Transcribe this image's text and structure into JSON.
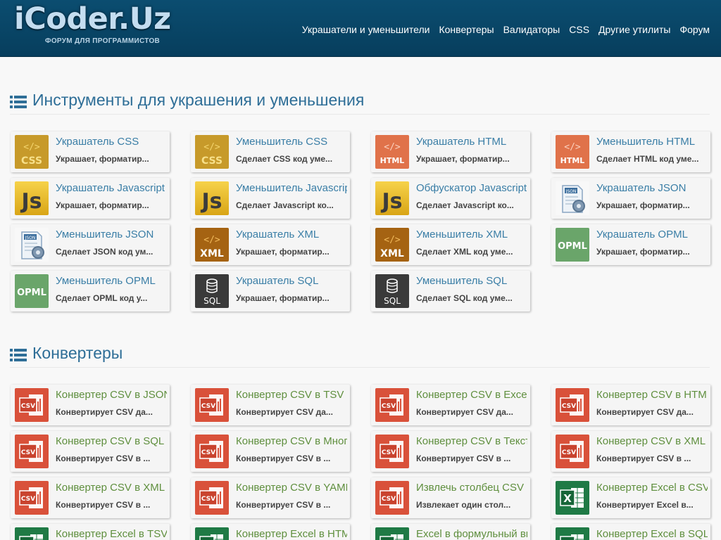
{
  "site": {
    "logo_text": "iCoder.Uz",
    "logo_subtitle": "ФОРУМ ДЛЯ ПРОГРАММИСТОВ"
  },
  "nav": {
    "items": [
      "Украшатели и уменьшители",
      "Конвертеры",
      "Валидаторы",
      "CSS",
      "Другие утилиты",
      "Форум"
    ]
  },
  "sections": [
    {
      "title": "Инструменты для украшения и уменьшения",
      "tools": [
        {
          "title": "Украшатель CSS",
          "desc": "Украшает, форматир...",
          "icon": "css-icon"
        },
        {
          "title": "Уменьшитель CSS",
          "desc": "Сделает CSS код уме...",
          "icon": "css-icon"
        },
        {
          "title": "Украшатель HTML",
          "desc": "Украшает, форматир...",
          "icon": "html-icon"
        },
        {
          "title": "Уменьшитель HTML",
          "desc": "Сделает HTML код уме...",
          "icon": "html-icon"
        },
        {
          "title": "Украшатель Javascript",
          "desc": "Украшает, форматир...",
          "icon": "js-icon"
        },
        {
          "title": "Уменьшитель Javascript",
          "desc": "Сделает Javascript ко...",
          "icon": "js-icon"
        },
        {
          "title": "Обфускатор Javascript",
          "desc": "Сделает Javascript ко...",
          "icon": "js-icon"
        },
        {
          "title": "Украшатель JSON",
          "desc": "Украшает, форматир...",
          "icon": "json-icon"
        },
        {
          "title": "Уменьшитель JSON",
          "desc": "Сделает JSON код ум...",
          "icon": "json-icon"
        },
        {
          "title": "Украшатель XML",
          "desc": "Украшает, форматир...",
          "icon": "xml-icon"
        },
        {
          "title": "Уменьшитель XML",
          "desc": "Сделает XML код уме...",
          "icon": "xml-icon"
        },
        {
          "title": "Украшатель OPML",
          "desc": "Украшает, форматир...",
          "icon": "opml-icon"
        },
        {
          "title": "Уменьшитель OPML",
          "desc": "Сделает OPML код у...",
          "icon": "opml-icon"
        },
        {
          "title": "Украшатель SQL",
          "desc": "Украшает, форматир...",
          "icon": "sql-icon"
        },
        {
          "title": "Уменьшитель SQL",
          "desc": "Сделает SQL код уме...",
          "icon": "sql-icon"
        }
      ]
    },
    {
      "title": "Конвертеры",
      "tools": [
        {
          "title": "Конвертер CSV в JSON",
          "desc": "Конвертирует CSV да...",
          "icon": "csv-icon"
        },
        {
          "title": "Конвертер CSV в TSV",
          "desc": "Конвертирует CSV да...",
          "icon": "csv-icon"
        },
        {
          "title": "Конвертер CSV в Excel",
          "desc": "Конвертирует CSV да...",
          "icon": "csv-icon"
        },
        {
          "title": "Конвертер CSV в HTML",
          "desc": "Конвертирует CSV да...",
          "icon": "csv-icon"
        },
        {
          "title": "Конвертер CSV в SQL",
          "desc": "Конвертирует CSV в ...",
          "icon": "csv-icon"
        },
        {
          "title": "Конвертер CSV в Много",
          "desc": "Конвертирует CSV в ...",
          "icon": "csv-icon"
        },
        {
          "title": "Конвертер CSV в Текст",
          "desc": "Конвертирует CSV в ...",
          "icon": "csv-icon"
        },
        {
          "title": "Конвертер CSV в XML",
          "desc": "Конвертирует CSV в ...",
          "icon": "csv-icon"
        },
        {
          "title": "Конвертер CSV в XML",
          "desc": "Конвертирует CSV в ...",
          "icon": "csv-icon"
        },
        {
          "title": "Конвертер CSV в YAML",
          "desc": "Конвертирует CSV в ...",
          "icon": "csv-icon"
        },
        {
          "title": "Извлечь столбец CSV",
          "desc": "Извлекает один стол...",
          "icon": "csv-icon"
        },
        {
          "title": "Конвертер Excel в CSV",
          "desc": "Конвертирует Excel в...",
          "icon": "excel-icon"
        },
        {
          "title": "Конвертер Excel в TSV",
          "desc": "",
          "icon": "excel-icon"
        },
        {
          "title": "Конвертер Excel в HTML",
          "desc": "",
          "icon": "excel-icon"
        },
        {
          "title": "Excel в формульный вид",
          "desc": "",
          "icon": "excel-icon"
        },
        {
          "title": "Конвертер Excel в SQL",
          "desc": "",
          "icon": "excel-icon"
        }
      ]
    }
  ],
  "colors": {
    "navbar": "#0b4d70",
    "heading": "#2e6e97",
    "tool_title_blue": "#3a7ea6",
    "tool_title_green": "#5f8f3e",
    "css_icon": "#c79a2a",
    "html_icon": "#e0724a",
    "js_icon": "#e8b923",
    "xml_icon": "#a56312",
    "opml_icon": "#6aa56a",
    "sql_icon": "#3a3a3a",
    "csv_icon": "#d9513a",
    "excel_icon": "#1f7a45"
  }
}
